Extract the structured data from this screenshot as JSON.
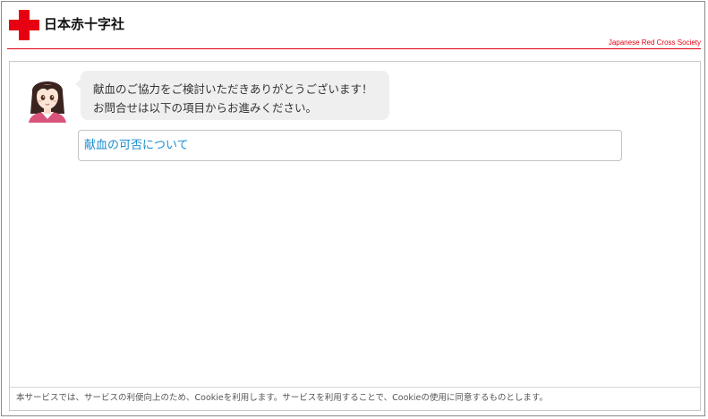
{
  "header": {
    "logo_text": "日本赤十字社",
    "subtitle": "Japanese Red Cross Society",
    "brand_color": "#e60012"
  },
  "chat": {
    "bot_message_line1": "献血のご協力をご検討いただきありがとうございます！",
    "bot_message_line2": "お問合せは以下の項目からお進みください。",
    "options": [
      {
        "label": "献血の可否について"
      }
    ]
  },
  "footer": {
    "notice": "本サービスでは、サービスの利便向上のため、Cookieを利用します。サービスを利用することで、Cookieの使用に同意するものとします。"
  },
  "icons": {
    "logo": "red-cross-icon",
    "avatar": "nurse-avatar-icon"
  }
}
